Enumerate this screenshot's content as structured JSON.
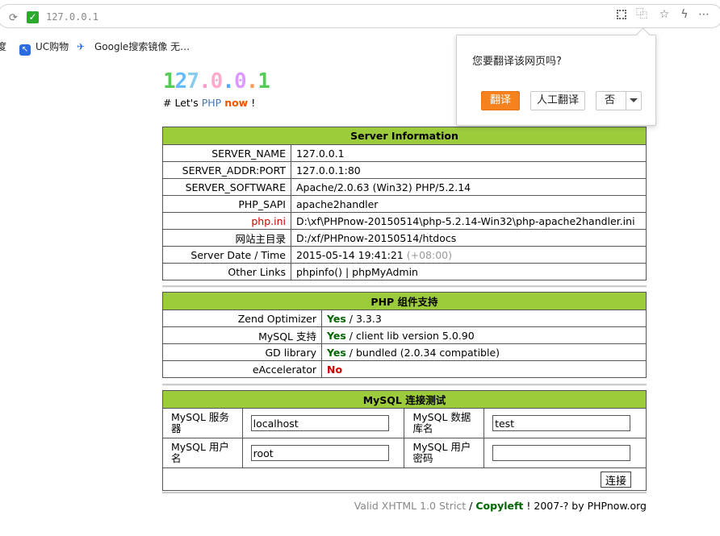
{
  "browser": {
    "url": "127.0.0.1",
    "bookmarks": [
      {
        "label": "度"
      },
      {
        "label": "UC购物",
        "icon": "uc-icon"
      },
      {
        "label": "Google搜索镜像 无…",
        "icon": "bird-icon"
      }
    ]
  },
  "translate_popup": {
    "question": "您要翻译该网页吗?",
    "translate_label": "翻译",
    "human_translate_label": "人工翻译",
    "no_label": "否"
  },
  "header": {
    "logo_chars": [
      {
        "ch": "1",
        "color": "#55cc55"
      },
      {
        "ch": "2",
        "color": "#66bbff"
      },
      {
        "ch": "7",
        "color": "#88ccee"
      },
      {
        "ch": ".",
        "color": "#ff99cc"
      },
      {
        "ch": "0",
        "color": "#ffaacc"
      },
      {
        "ch": ".",
        "color": "#55aaff"
      },
      {
        "ch": "0",
        "color": "#dd99ff"
      },
      {
        "ch": ".",
        "color": "#ff9955"
      },
      {
        "ch": "1",
        "color": "#55cc55"
      }
    ],
    "tag_prefix": "# Let's ",
    "tag_php": "PHP",
    "tag_now": "now",
    "tag_suffix": " !"
  },
  "server_info": {
    "title": "Server Information",
    "rows": [
      {
        "key": "SERVER_NAME",
        "value": "127.0.0.1"
      },
      {
        "key": "SERVER_ADDR:PORT",
        "value": "127.0.0.1:80"
      },
      {
        "key": "SERVER_SOFTWARE",
        "value": "Apache/2.0.63 (Win32) PHP/5.2.14"
      },
      {
        "key": "PHP_SAPI",
        "value": "apache2handler"
      },
      {
        "key": "php.ini",
        "value": "D:\\xf\\PHPnow-20150514\\php-5.2.14-Win32\\php-apache2handler.ini"
      },
      {
        "key": "网站主目录",
        "value": "D:/xf/PHPnow-20150514/htdocs"
      },
      {
        "key": "Server Date / Time",
        "value": "2015-05-14 19:41:21",
        "extra": "(+08:00)"
      },
      {
        "key": "Other Links",
        "value": "",
        "links": [
          "phpinfo()",
          "phpMyAdmin"
        ]
      }
    ]
  },
  "php_components": {
    "title": "PHP 组件支持",
    "rows": [
      {
        "key": "Zend Optimizer",
        "status": "Yes",
        "detail": " / 3.3.3"
      },
      {
        "key": "MySQL 支持",
        "status": "Yes",
        "detail": " / client lib version 5.0.90"
      },
      {
        "key": "GD library",
        "status": "Yes",
        "detail": " / bundled (2.0.34 compatible)"
      },
      {
        "key": "eAccelerator",
        "status": "No",
        "detail": ""
      }
    ]
  },
  "mysql_test": {
    "title": "MySQL 连接测试",
    "server_label": "MySQL 服务器",
    "server_value": "localhost",
    "database_label": "MySQL 数据库名",
    "database_value": "test",
    "user_label": "MySQL 用户名",
    "user_value": "root",
    "password_label": "MySQL 用户密码",
    "password_value": "",
    "connect_label": "连接"
  },
  "footer": {
    "valid": "Valid XHTML 1.0 Strict",
    "sep": " / ",
    "copyleft": "Copyleft",
    "rest": " ! 2007-? by PHPnow.org"
  }
}
